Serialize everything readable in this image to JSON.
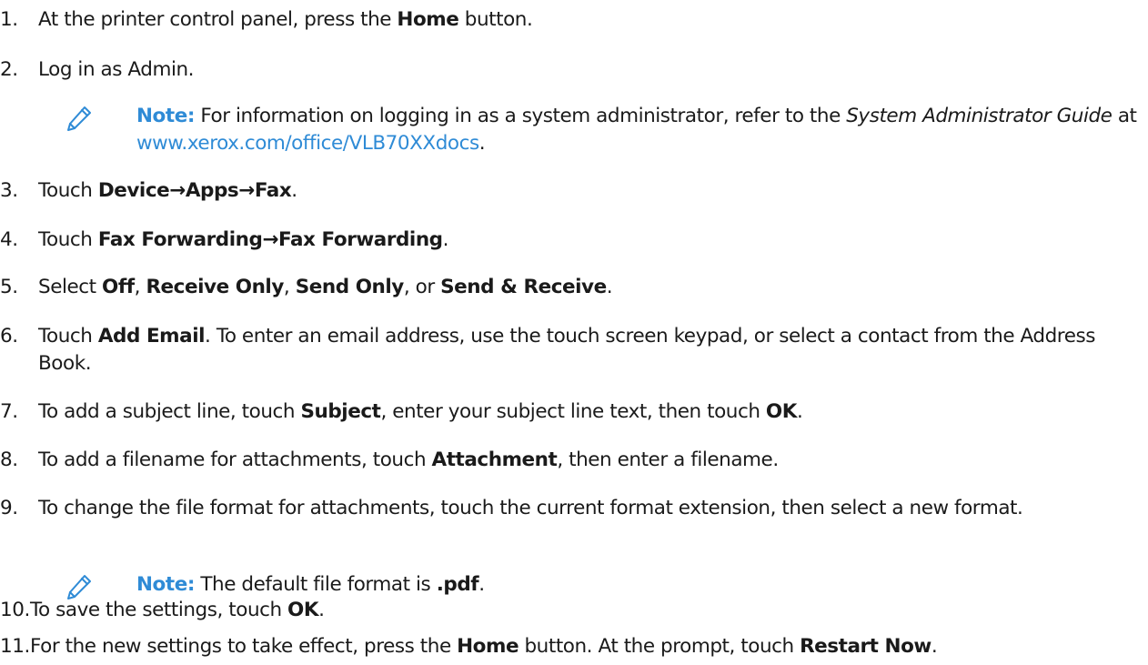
{
  "steps": [
    {
      "number": "1.",
      "parts": [
        "At the printer control panel, press the ",
        "Home",
        " button."
      ]
    },
    {
      "number": "2.",
      "parts": [
        "Log in as Admin."
      ]
    },
    {
      "number": "3.",
      "parts": [
        "Touch ",
        "Device→Apps→Fax",
        "."
      ]
    },
    {
      "number": "4.",
      "parts": [
        "Touch ",
        "Fax Forwarding→Fax Forwarding",
        "."
      ]
    },
    {
      "number": "5.",
      "parts": [
        "Select ",
        "Off",
        ", ",
        "Receive Only",
        ", ",
        "Send Only",
        ", or ",
        "Send & Receive",
        "."
      ]
    },
    {
      "number": "6.",
      "parts": [
        "Touch ",
        "Add Email",
        ". To enter an email address, use the touch screen keypad, or select a contact from the Address Book."
      ]
    },
    {
      "number": "7.",
      "parts": [
        "To add a subject line, touch ",
        "Subject",
        ", enter your subject line text, then touch ",
        "OK",
        "."
      ]
    },
    {
      "number": "8.",
      "parts": [
        "To add a filename for attachments, touch ",
        "Attachment",
        ", then enter a filename."
      ]
    },
    {
      "number": "9.",
      "parts": [
        "To change the file format for attachments, touch the current format extension, then select a new format."
      ]
    },
    {
      "number": "10.",
      "parts": [
        "To save the settings, touch ",
        "OK",
        "."
      ]
    },
    {
      "number": "11.",
      "parts": [
        "For the new settings to take effect, press the ",
        "Home",
        " button. At the prompt, touch ",
        "Restart Now",
        "."
      ]
    }
  ],
  "notes": [
    {
      "label": "Note:",
      "parts": [
        " For information on logging in as a system administrator, refer to the ",
        "System Administrator Guide",
        " at ",
        "www.xerox.com/office/VLB70XXdocs",
        "."
      ]
    },
    {
      "label": "Note:",
      "parts": [
        " The default file format is ",
        ".pdf",
        "."
      ]
    }
  ],
  "colors": {
    "accent": "#2f8bd6",
    "text": "#1a1a1a"
  },
  "icons": {
    "note": "pencil-icon"
  }
}
